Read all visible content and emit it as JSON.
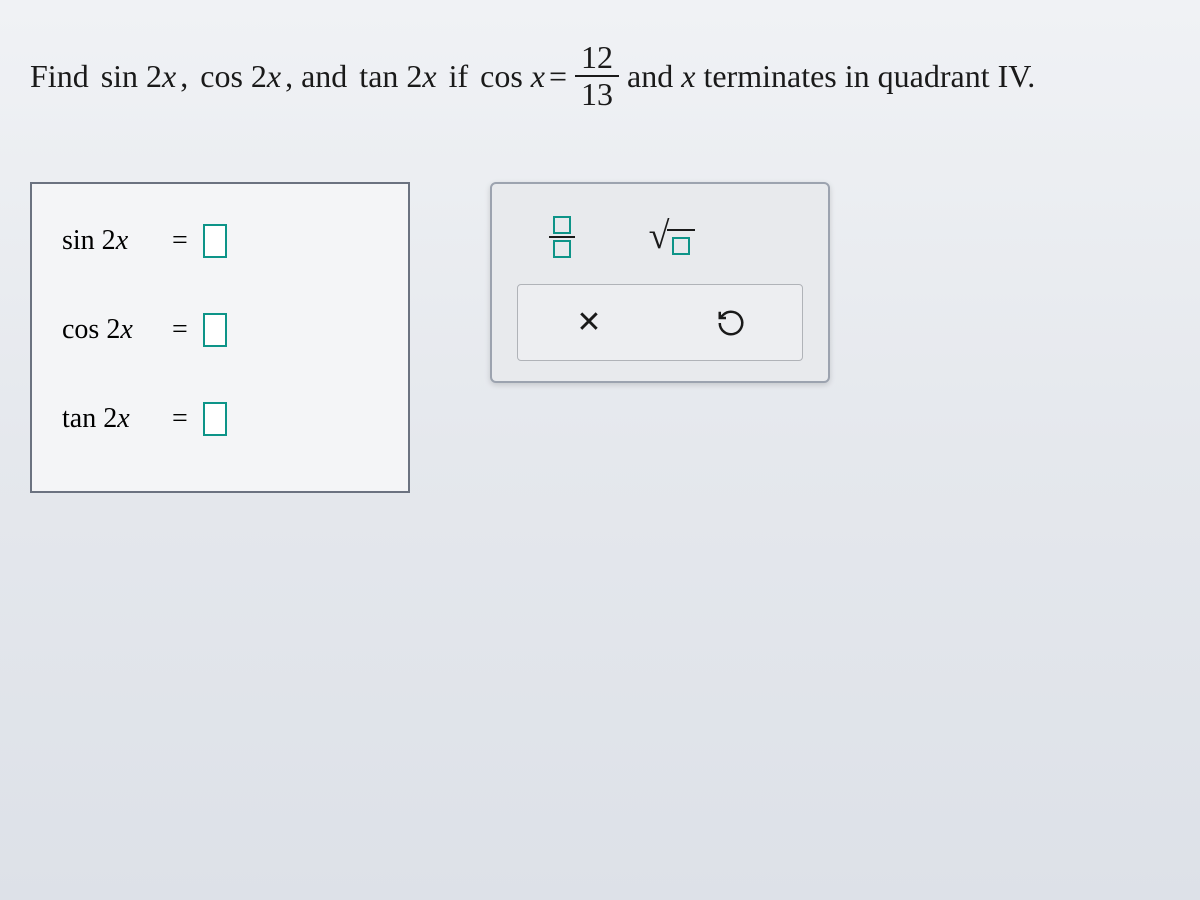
{
  "question": {
    "prefix": "Find",
    "func1": "sin 2",
    "var1": "x",
    "sep1": ",",
    "func2": "cos 2",
    "var2": "x",
    "sep2": ", and",
    "func3": "tan 2",
    "var3": "x",
    "iftext": "if",
    "cosx": "cos",
    "varx": "x",
    "eq": "=",
    "frac_num": "12",
    "frac_den": "13",
    "suffix1": "and",
    "varx2": "x",
    "suffix2": "terminates in quadrant IV."
  },
  "answers": {
    "row1": {
      "func": "sin 2",
      "var": "x",
      "eq": "="
    },
    "row2": {
      "func": "cos 2",
      "var": "x",
      "eq": "="
    },
    "row3": {
      "func": "tan 2",
      "var": "x",
      "eq": "="
    }
  },
  "tools": {
    "fraction": "fraction-tool",
    "sqrt": "sqrt-tool",
    "clear": "clear",
    "reset": "reset"
  }
}
